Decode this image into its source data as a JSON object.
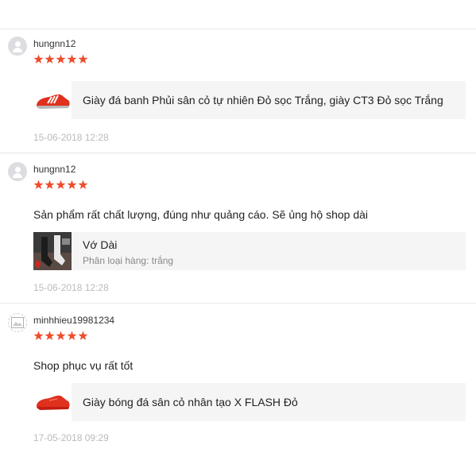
{
  "colors": {
    "star": "#ee4d2d",
    "shoe_red": "#e0301e"
  },
  "reviews": [
    {
      "username": "hungnn12",
      "rating": 5,
      "comment": "",
      "product": {
        "name": "Giày đá banh Phủi sân cỏ tự nhiên Đỏ sọc Trắng, giày CT3 Đỏ sọc Trắng",
        "variation": "",
        "thumb_icon": "red-shoe-white-stripes-icon"
      },
      "date": "15-06-2018 12:28",
      "avatar": "user-icon"
    },
    {
      "username": "hungnn12",
      "rating": 5,
      "comment": "Sản phẩm rất chất lượng, đúng như quảng cáo. Sẽ ủng hộ shop dài",
      "product": {
        "name": "Vớ Dài",
        "variation": "Phân loại hàng: trắng",
        "thumb_icon": "socks-photo-icon"
      },
      "date": "15-06-2018 12:28",
      "avatar": "user-icon"
    },
    {
      "username": "minhhieu19981234",
      "rating": 5,
      "comment": "Shop phục vụ rất tốt",
      "product": {
        "name": "Giày bóng đá sân cỏ nhân tạo X FLASH Đỏ",
        "variation": "",
        "thumb_icon": "red-shoe-icon"
      },
      "date": "17-05-2018 09:29",
      "avatar": "broken-image-icon"
    }
  ]
}
